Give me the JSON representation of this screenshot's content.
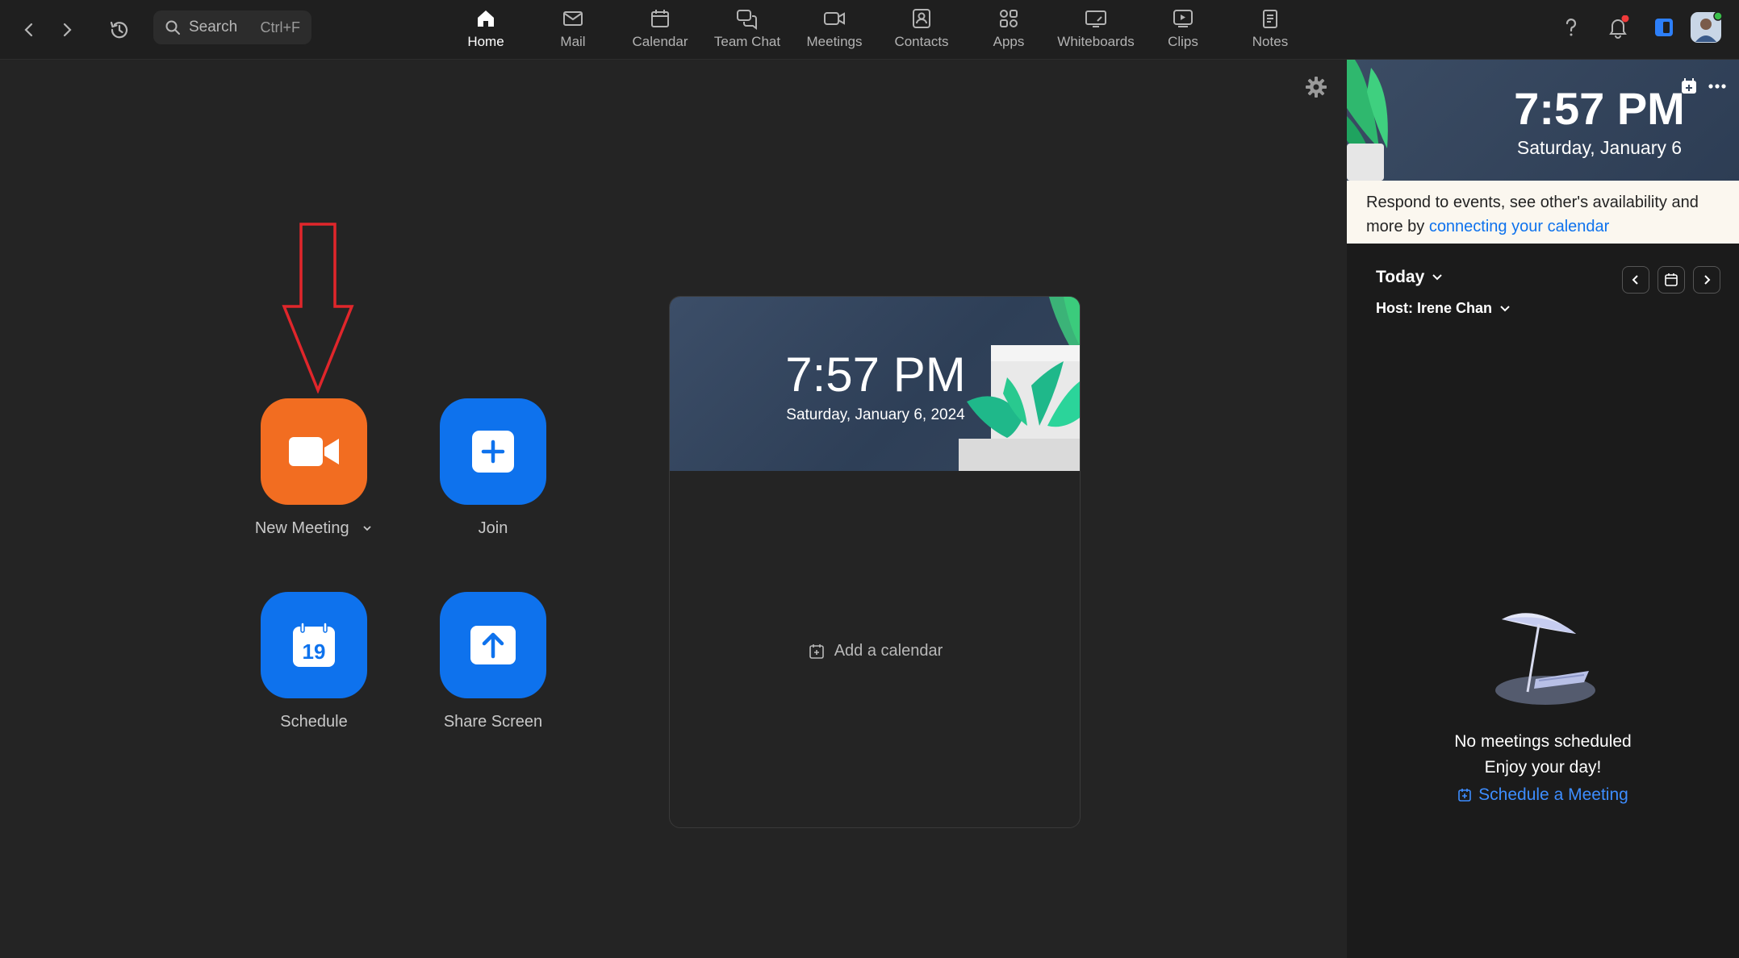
{
  "topbar": {
    "search": {
      "label": "Search",
      "shortcut": "Ctrl+F"
    },
    "tabs": [
      {
        "label": "Home",
        "icon": "home-icon",
        "active": true
      },
      {
        "label": "Mail",
        "icon": "mail-icon"
      },
      {
        "label": "Calendar",
        "icon": "calendar-icon"
      },
      {
        "label": "Team Chat",
        "icon": "chat-icon"
      },
      {
        "label": "Meetings",
        "icon": "video-icon"
      },
      {
        "label": "Contacts",
        "icon": "contacts-icon"
      },
      {
        "label": "Apps",
        "icon": "apps-icon"
      },
      {
        "label": "Whiteboards",
        "icon": "whiteboard-icon"
      },
      {
        "label": "Clips",
        "icon": "clips-icon"
      },
      {
        "label": "Notes",
        "icon": "notes-icon"
      }
    ]
  },
  "actions": {
    "new_meeting": "New Meeting",
    "join": "Join",
    "schedule": "Schedule",
    "schedule_day": "19",
    "share_screen": "Share Screen"
  },
  "card": {
    "time": "7:57 PM",
    "date": "Saturday, January 6, 2024",
    "add_calendar": "Add a calendar"
  },
  "right_panel": {
    "time": "7:57 PM",
    "date": "Saturday, January 6",
    "banner_text": "Respond to events, see other's availability and more by ",
    "banner_link": "connecting your calendar",
    "today_label": "Today",
    "host_label": "Host: Irene Chan",
    "empty_title": "No meetings scheduled",
    "empty_subtitle": "Enjoy your day!",
    "schedule_link": "Schedule a Meeting"
  },
  "colors": {
    "accent_blue": "#0e72ed",
    "accent_orange": "#f26d21",
    "annotation_red": "#e0262b",
    "notification_red": "#f03a3a",
    "status_green": "#3ac04a"
  }
}
